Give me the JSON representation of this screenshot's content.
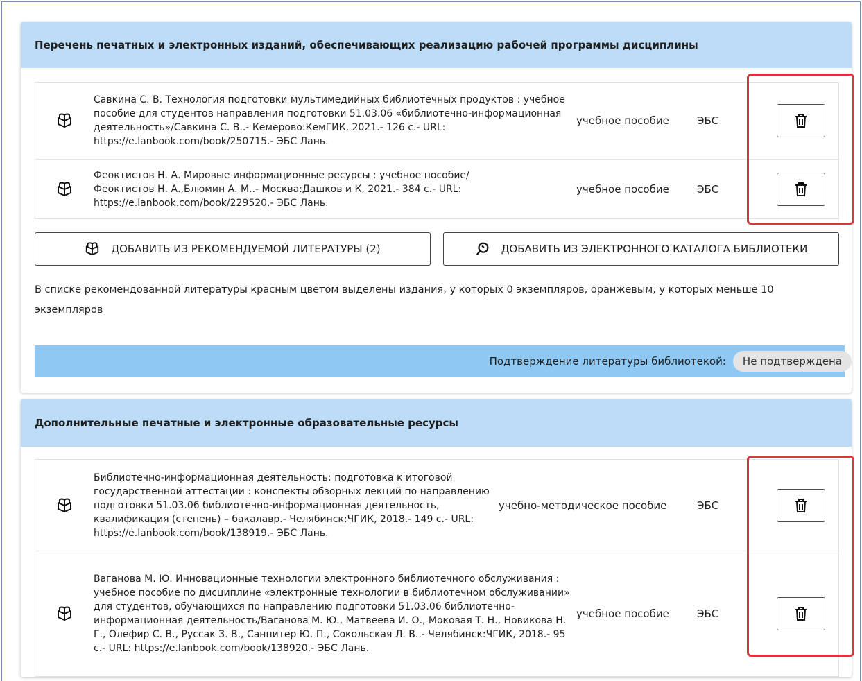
{
  "section1": {
    "title": "Перечень печатных и электронных изданий, обеспечивающих реализацию рабочей программы дисциплины",
    "items": [
      {
        "title": "Савкина С. В. Технология подготовки мультимедийных библиотечных продуктов : учебное пособие для студентов направления подготовки 51.03.06 «библиотечно-информационная деятельность»/Савкина С. В..- Кемерово:КемГИК, 2021.- 126 с.- URL: https://e.lanbook.com/book/250715.- ЭБС Лань.",
        "type": "учебное пособие",
        "source": "ЭБС"
      },
      {
        "title": "Феоктистов Н. А. Мировые информационные ресурсы : учебное пособие/ Феоктистов Н. А.,Блюмин А. М..- Москва:Дашков и К, 2021.- 384 с.- URL: https://e.lanbook.com/book/229520.- ЭБС Лань.",
        "type": "учебное пособие",
        "source": "ЭБС"
      }
    ],
    "add_recommended_label": "ДОБАВИТЬ ИЗ РЕКОМЕНДУЕМОЙ ЛИТЕРАТУРЫ (2)",
    "add_catalog_label": "ДОБАВИТЬ ИЗ ЭЛЕКТРОННОГО КАТАЛОГА БИБЛИОТЕКИ",
    "note": "В списке рекомендованной литературы красным цветом выделены издания, у которых 0 экземпляров, оранжевым, у которых меньше 10 экземпляров",
    "confirm_label": "Подтверждение литературы библиотекой:",
    "confirm_status": "Не подтверждена"
  },
  "section2": {
    "title": "Дополнительные печатные и электронные образовательные ресурсы",
    "items": [
      {
        "title": "Библиотечно-информационная деятельность: подготовка к итоговой государственной аттестации : конспекты обзорных лекций по направлению подготовки 51.03.06 библиотечно-информационная деятельность, квалификация (степень) – бакалавр.- Челябинск:ЧГИК, 2018.- 149 с.- URL: https://e.lanbook.com/book/138919.- ЭБС Лань.",
        "type": "учебно-методическое пособие",
        "source": "ЭБС"
      },
      {
        "title": "Ваганова М. Ю. Инновационные технологии электронного библиотечного обслуживания : учебное пособие по дисциплине «электронные технологии в библиотечном обслуживании» для студентов, обучающихся по направлению подготовки 51.03.06 библиотечно-информационная деятельность/Ваганова М. Ю., Матвеева И. О., Моковая Т. Н., Новикова Н. Г., Олефир С. В., Руссак З. В., Санпитер Ю. П., Сокольская Л. В..- Челябинск:ЧГИК, 2018.- 95 с.- URL: https://e.lanbook.com/book/138920.- ЭБС Лань.",
        "type": "учебное пособие",
        "source": "ЭБС"
      }
    ]
  },
  "icons": {
    "book": "book-open-icon",
    "delete": "trash-icon",
    "search": "search-icon"
  },
  "colors": {
    "header_bg": "#bcdcf7",
    "confirm_bar_bg": "#8ec8f3",
    "highlight": "#d9363e"
  }
}
